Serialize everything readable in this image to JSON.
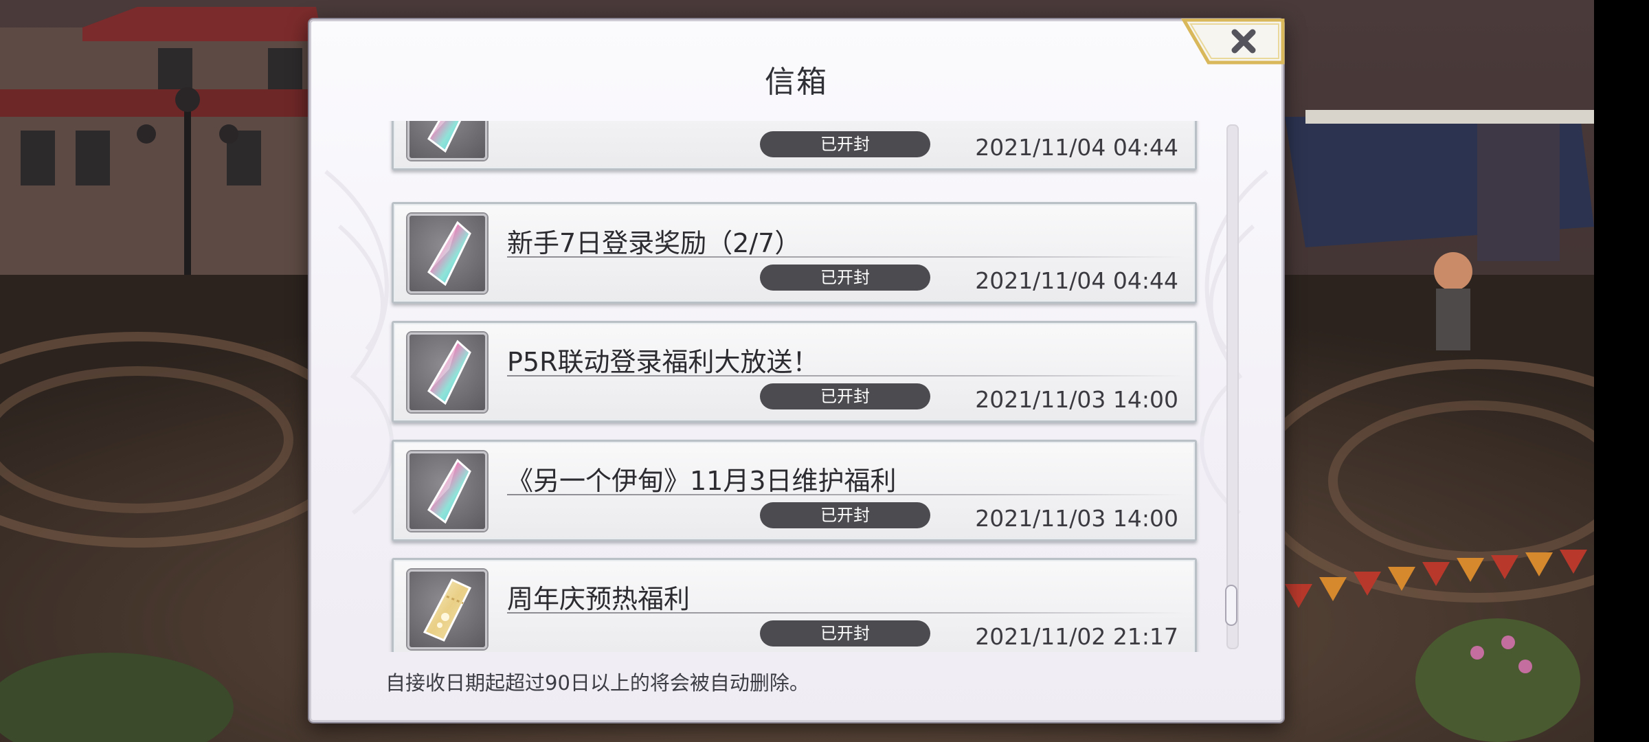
{
  "window": {
    "title": "信箱",
    "close_icon": "close-x-icon"
  },
  "colors": {
    "badge_bg": "#4c4c50",
    "close_border": "#d8b85a",
    "panel_bg": "#f6f5f9"
  },
  "mail_items": [
    {
      "title": "",
      "status": "已开封",
      "date": "2021/11/04 04:44",
      "icon": "rainbow-crystal-icon"
    },
    {
      "title": "新手7日登录奖励（2/7）",
      "status": "已开封",
      "date": "2021/11/04 04:44",
      "icon": "rainbow-crystal-icon"
    },
    {
      "title": "P5R联动登录福利大放送！",
      "status": "已开封",
      "date": "2021/11/03 14:00",
      "icon": "rainbow-crystal-icon"
    },
    {
      "title": "《另一个伊甸》11月3日维护福利",
      "status": "已开封",
      "date": "2021/11/03 14:00",
      "icon": "rainbow-crystal-icon"
    },
    {
      "title": "周年庆预热福利",
      "status": "已开封",
      "date": "2021/11/02 21:17",
      "icon": "gold-ticket-icon"
    }
  ],
  "footer": {
    "note": "自接收日期起超过90日以上的将会被自动删除。"
  }
}
